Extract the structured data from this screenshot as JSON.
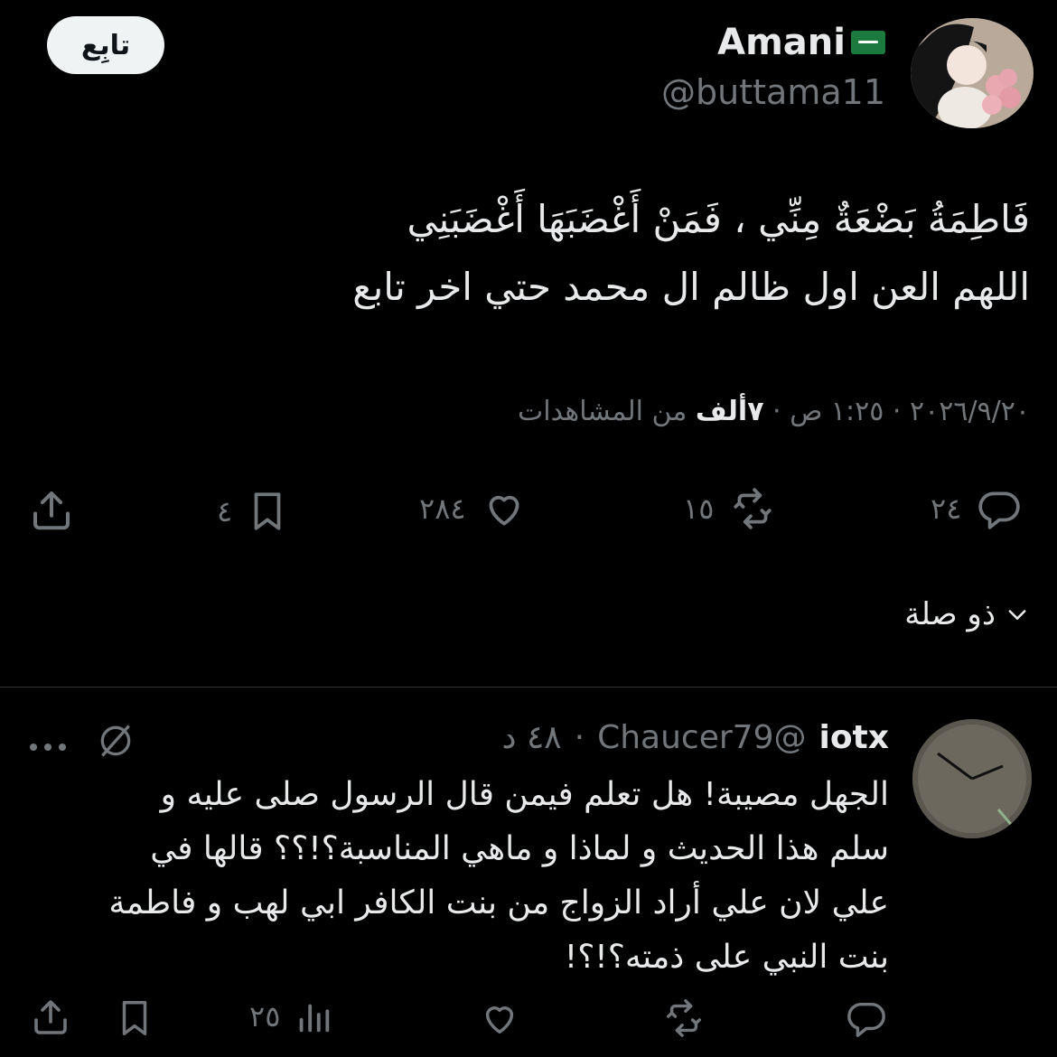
{
  "header": {
    "follow_label": "تابِع",
    "display_name": "Amani",
    "handle": "@buttama11"
  },
  "tweet": {
    "line1": "فَاطِمَةُ بَضْعَةٌ مِنِّي ، فَمَنْ أَغْضَبَهَا أَغْضَبَنِي",
    "line2": "اللهم العن اول ظالم ال محمد حتي اخر تابع",
    "date": "٢٠٢٦/٩/٢٠",
    "time": "١:٢٥ ص",
    "views_count": "٧ألف",
    "views_label": "من المشاهدات"
  },
  "actions": {
    "replies": "٢٤",
    "reposts": "١٥",
    "likes": "٢٨٤",
    "bookmarks": "٤"
  },
  "related_label": "ذو صلة",
  "reply": {
    "name": "iotx",
    "handle": "@Chaucer79",
    "time": "٤٨ د",
    "text_lines": [
      "الجهل مصيبة! هل تعلم فيمن قال الرسول صلى عليه و",
      "سلم هذا الحديث و لماذا و ماهي المناسبة؟!؟؟ قالها في",
      "علي لان علي أراد الزواج من بنت الكافر ابي لهب و فاطمة",
      "بنت النبي على ذمته؟!؟!"
    ],
    "views": "٢٥"
  },
  "colors": {
    "background": "#000000",
    "text": "#e7e9ea",
    "secondary": "#71767b",
    "follow_bg": "#eff3f4"
  },
  "icons": [
    "share-icon",
    "bookmark-icon",
    "heart-icon",
    "repost-icon",
    "reply-icon",
    "chevron-down-icon",
    "grok-icon",
    "more-icon",
    "views-icon",
    "flag-sa-icon"
  ]
}
